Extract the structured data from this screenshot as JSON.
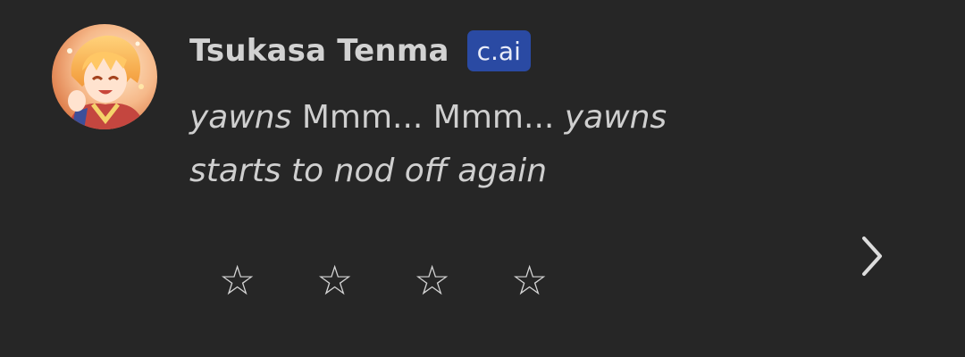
{
  "message": {
    "author_name": "Tsukasa Tenma",
    "badge_label": "c.ai",
    "avatar_alt": "Tsukasa Tenma avatar",
    "text_line1_action": "yawns",
    "text_line1_speech": " Mmm... Mmm... ",
    "text_line1_action2": "yawns",
    "text_line2_action": "starts to nod off again"
  },
  "rating": {
    "stars": [
      "☆",
      "☆",
      "☆",
      "☆"
    ],
    "selected": 0,
    "max": 4
  },
  "icons": {
    "next": "chevron-right-icon",
    "star": "star-outline-icon"
  },
  "colors": {
    "background": "#262626",
    "badge": "#2a4aa3",
    "text": "#cfcfcf"
  }
}
